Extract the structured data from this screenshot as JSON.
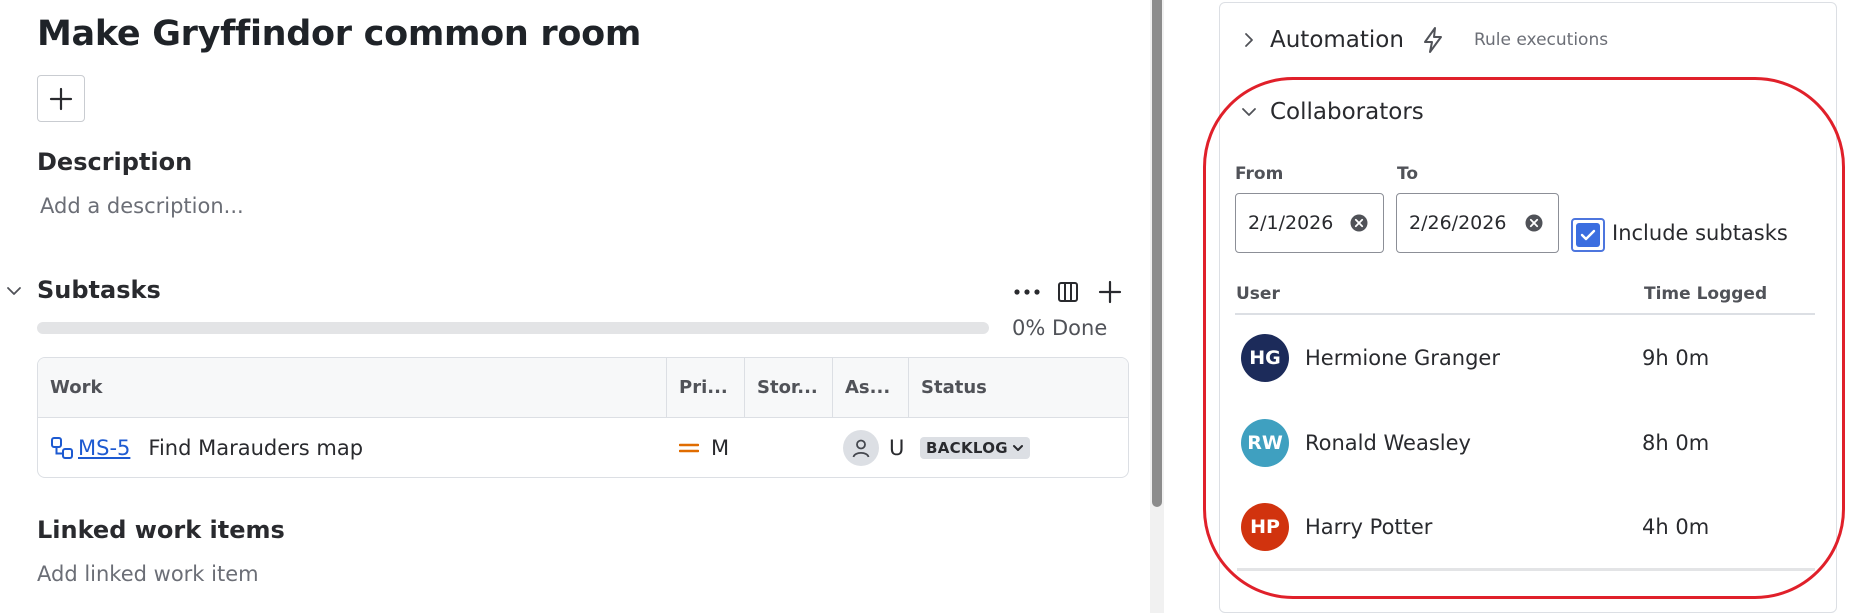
{
  "issue": {
    "title": "Make Gryffindor common room"
  },
  "description": {
    "heading": "Description",
    "placeholder": "Add a description..."
  },
  "subtasks": {
    "heading": "Subtasks",
    "progress_percent": 0,
    "progress_label": "0% Done",
    "columns": [
      "Work",
      "Pri...",
      "Stor...",
      "As...",
      "Status"
    ],
    "rows": [
      {
        "key": "MS-5",
        "summary": "Find Marauders map",
        "priority": "M",
        "assignee": "U",
        "status": "BACKLOG"
      }
    ]
  },
  "linked": {
    "heading": "Linked work items",
    "placeholder": "Add linked work item"
  },
  "automation": {
    "label": "Automation",
    "rule_executions": "Rule executions"
  },
  "collaborators": {
    "label": "Collaborators",
    "from_label": "From",
    "from_value": "2/1/2026",
    "to_label": "To",
    "to_value": "2/26/2026",
    "include_subtasks_label": "Include subtasks",
    "include_subtasks_checked": true,
    "col_user": "User",
    "col_time": "Time Logged",
    "users": [
      {
        "initials": "HG",
        "name": "Hermione Granger",
        "time": "9h 0m",
        "color": "#1c2b5a"
      },
      {
        "initials": "RW",
        "name": "Ronald Weasley",
        "time": "8h 0m",
        "color": "#3fa0c0"
      },
      {
        "initials": "HP",
        "name": "Harry Potter",
        "time": "4h 0m",
        "color": "#d1330e"
      }
    ]
  },
  "colors": {
    "link": "#1d5ad1",
    "highlight": "#e0202a",
    "checkbox": "#3b6ee0",
    "priority_medium": "#e06c00"
  }
}
